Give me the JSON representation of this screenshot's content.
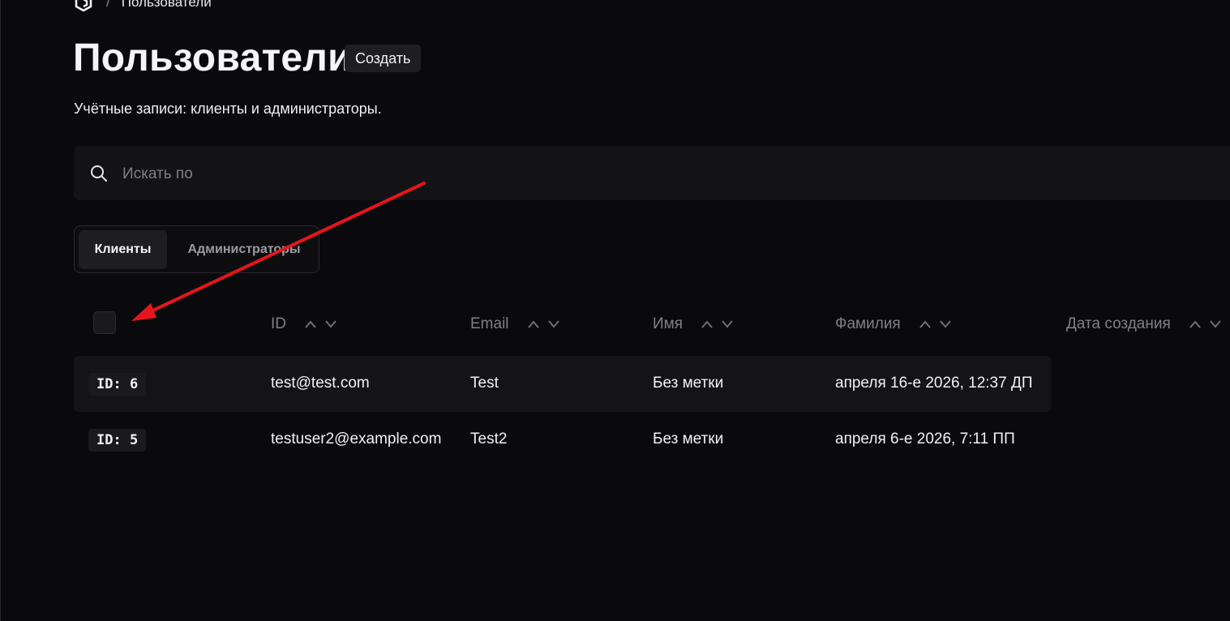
{
  "breadcrumb": {
    "logo_icon": "hexagon-logo-icon",
    "separator": "/",
    "current": "Пользователи"
  },
  "header": {
    "title": "Пользователи",
    "create_label": "Создать",
    "subtitle": "Учётные записи: клиенты и администраторы."
  },
  "search": {
    "icon": "search-icon",
    "placeholder": "Искать по",
    "value": ""
  },
  "tabs": [
    {
      "label": "Клиенты",
      "active": true
    },
    {
      "label": "Администраторы",
      "active": false
    }
  ],
  "table": {
    "columns": [
      {
        "label": "ID"
      },
      {
        "label": "Email"
      },
      {
        "label": "Имя"
      },
      {
        "label": "Фамилия"
      },
      {
        "label": "Дата создания"
      }
    ],
    "rows": [
      {
        "id": "ID: 6",
        "email": "test@test.com",
        "first_name": "Test",
        "last_name": "Без метки",
        "created": "апреля 16-е 2026, 12:37 ДП"
      },
      {
        "id": "ID: 5",
        "email": "testuser2@example.com",
        "first_name": "Test2",
        "last_name": "Без метки",
        "created": "апреля 6-е 2026, 7:11 ПП"
      }
    ]
  },
  "colors": {
    "background": "#0a0a0c",
    "surface": "#131316",
    "annotation_arrow": "#e8141c"
  }
}
